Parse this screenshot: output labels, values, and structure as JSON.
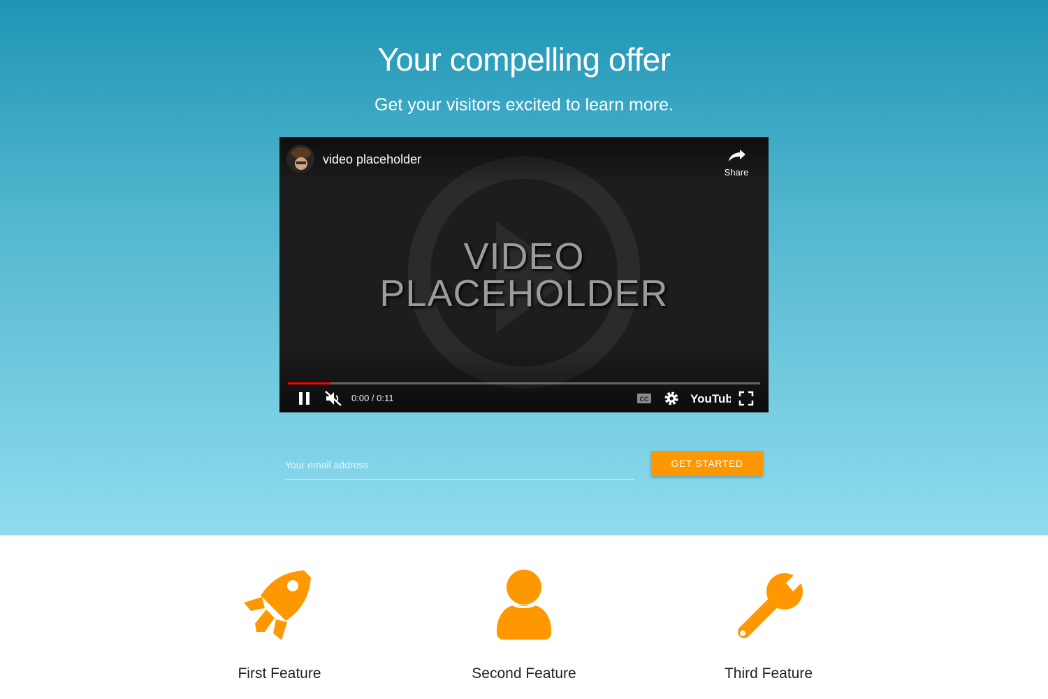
{
  "hero": {
    "title": "Your compelling offer",
    "subtitle": "Get your visitors excited to learn more."
  },
  "video": {
    "title": "video placeholder",
    "share_label": "Share",
    "placeholder_line1": "VIDEO",
    "placeholder_line2": "PLACEHOLDER",
    "time": "0:00 / 0:11",
    "progress_fraction": 0.09,
    "brand": "YouTube",
    "icons": [
      "channel-avatar",
      "share-icon",
      "pause-icon",
      "muted-volume-icon",
      "captions-icon",
      "settings-gear-icon",
      "youtube-logo",
      "fullscreen-icon"
    ]
  },
  "signup": {
    "email_placeholder": "Your email address",
    "email_value": "",
    "button_label": "GET STARTED"
  },
  "features": [
    {
      "title": "First Feature",
      "icon": "rocket-icon"
    },
    {
      "title": "Second Feature",
      "icon": "person-icon"
    },
    {
      "title": "Third Feature",
      "icon": "wrench-icon"
    }
  ],
  "colors": {
    "accent": "#ff9800",
    "hero_top": "#1f95b4",
    "hero_bottom": "#8fdcee",
    "progress": "#ff0000"
  }
}
